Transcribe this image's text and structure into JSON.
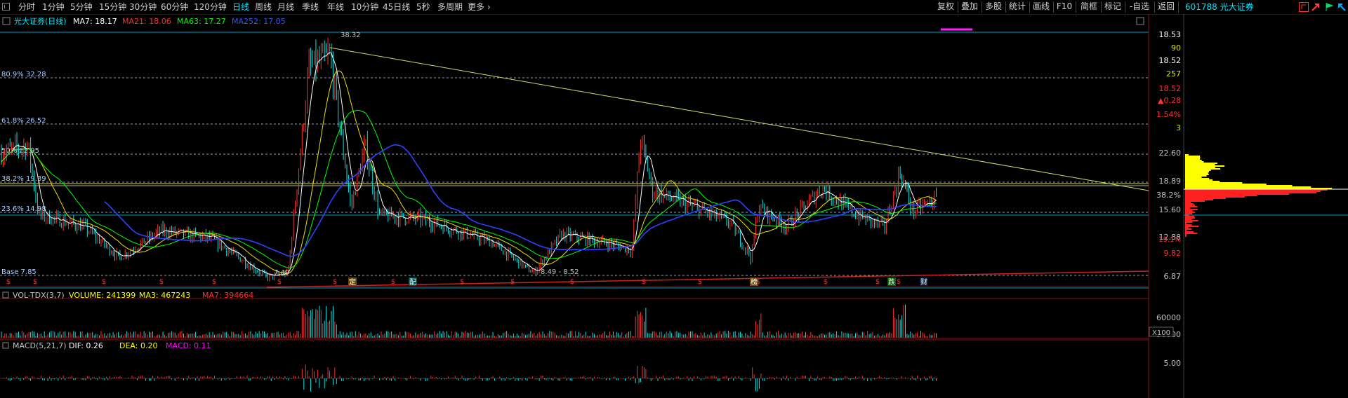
{
  "toolbar": {
    "periods": [
      "分时",
      "1分钟",
      "5分钟",
      "15分钟",
      "30分钟",
      "60分钟",
      "120分钟",
      "日线",
      "周线",
      "月线",
      "季线",
      "年线",
      "10分钟",
      "45日线",
      "5秒",
      "多周期",
      "更多 ›"
    ],
    "active_period": "日线",
    "right_buttons": [
      "复权",
      "叠加",
      "多股",
      "统计",
      "画线",
      "F10",
      "简框",
      "标记",
      "-自选",
      "返回"
    ],
    "stock_label": "601788 光大证券"
  },
  "main_panel": {
    "stock_name": "光大证券(日线)",
    "ma_legend": [
      {
        "label": "MA7: 18.17",
        "color": "#ffffff"
      },
      {
        "label": "MA21: 18.06",
        "color": "#ff3030"
      },
      {
        "label": "MA63: 17.27",
        "color": "#00ff00"
      },
      {
        "label": "MA252: 17.05",
        "color": "#3a50ff"
      }
    ],
    "peak_label": "38.32",
    "low_label": "7.49",
    "range_label": "8.49 - 8.52",
    "fib_levels": [
      {
        "label": "80.9% 32.28",
        "price": 32.28
      },
      {
        "label": "61.8% 26.52",
        "price": 26.52
      },
      {
        "label": "50% 22.95",
        "price": 22.95
      },
      {
        "label": "38.2% 19.39",
        "price": 19.39
      },
      {
        "label": "23.6% 14.98",
        "price": 14.98
      },
      {
        "label": "Base 7.85",
        "price": 7.85
      }
    ],
    "y_axis_labels": [
      "18.53",
      "90",
      "18.52",
      "257",
      "18.52",
      "▲0.28",
      "1.54%",
      "3",
      "22.60",
      "18.89",
      "15.60",
      "12.88",
      "9.82",
      "6.87"
    ],
    "vp_label": "38.2%",
    "vp_price": "19.1%",
    "event_markers": [
      "定",
      "配",
      "榜",
      "跌",
      "财"
    ],
    "dollar_marker": "$"
  },
  "volume_panel": {
    "title": "VOL-TDX(3,7)",
    "legend": [
      {
        "label": "VOLUME: 241399",
        "color": "#ffff00"
      },
      {
        "label": "MA3: 467243",
        "color": "#ffff00"
      },
      {
        "label": "MA7: 394664",
        "color": "#ff3030"
      }
    ],
    "y_labels": [
      "60000",
      "30000"
    ],
    "unit": "X100"
  },
  "macd_panel": {
    "title": "MACD(5,21,7)",
    "legend": [
      {
        "label": "DIF: 0.26",
        "color": "#ffffff"
      },
      {
        "label": "DEA: 0.20",
        "color": "#ffff00"
      },
      {
        "label": "MACD: 0.11",
        "color": "#ff00ff"
      }
    ],
    "y_labels": [
      "5.00"
    ]
  },
  "colors": {
    "up": "#ff3030",
    "down": "#00e5e5",
    "accent": "#00e5ff",
    "trend_line": "#c8e070"
  }
}
